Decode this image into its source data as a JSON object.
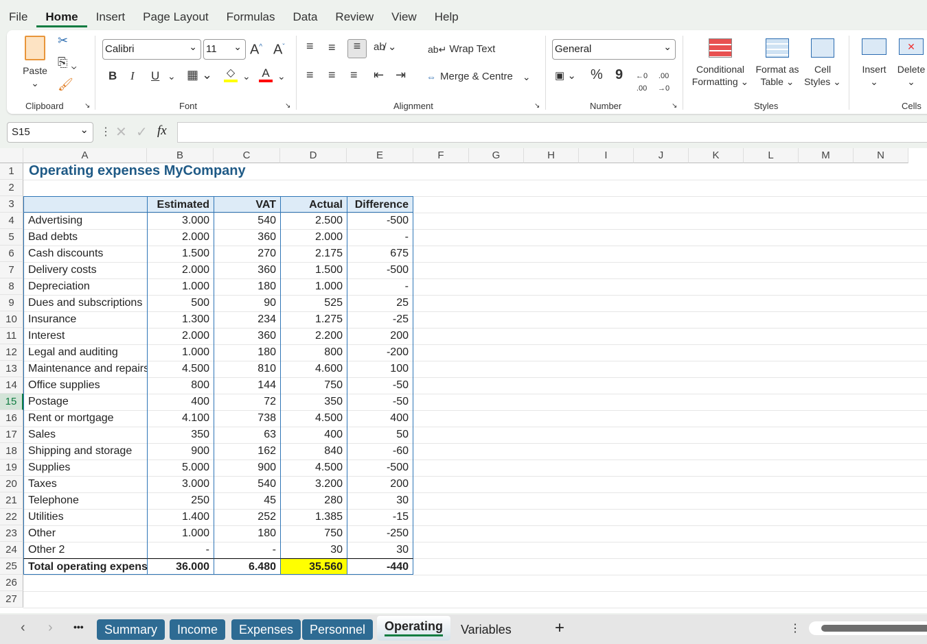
{
  "menu": [
    "File",
    "Home",
    "Insert",
    "Page Layout",
    "Formulas",
    "Data",
    "Review",
    "View",
    "Help"
  ],
  "ribbon": {
    "clipboard": {
      "label": "Clipboard",
      "paste": "Paste"
    },
    "font": {
      "label": "Font",
      "name": "Calibri",
      "size": "11",
      "bold": "B",
      "italic": "I",
      "underline": "U",
      "fill_color": "#ffff00",
      "font_color": "#ff0000"
    },
    "alignment": {
      "label": "Alignment",
      "wrap": "Wrap Text",
      "merge": "Merge & Centre"
    },
    "number": {
      "label": "Number",
      "format": "General",
      "percent": "%",
      "comma": "9"
    },
    "styles": {
      "label": "Styles",
      "conditional": [
        "Conditional",
        "Formatting"
      ],
      "format_table": [
        "Format as",
        "Table"
      ],
      "cell_styles": [
        "Cell",
        "Styles"
      ]
    },
    "cells": {
      "label": "Cells",
      "insert": "Insert",
      "delete": "Delete"
    }
  },
  "formula_bar": {
    "name_box": "S15",
    "fx": "fx",
    "value": ""
  },
  "columns": [
    "A",
    "B",
    "C",
    "D",
    "E",
    "F",
    "G",
    "H",
    "I",
    "J",
    "K",
    "L",
    "M",
    "N"
  ],
  "rows": [
    "1",
    "2",
    "3",
    "4",
    "5",
    "6",
    "7",
    "8",
    "9",
    "10",
    "11",
    "12",
    "13",
    "14",
    "15",
    "16",
    "17",
    "18",
    "19",
    "20",
    "21",
    "22",
    "23",
    "24",
    "25",
    "26",
    "27"
  ],
  "selected_row": "15",
  "title": "Operating expenses MyCompany",
  "table": {
    "headers": [
      "",
      "Estimated",
      "VAT",
      "Actual",
      "Difference"
    ],
    "rows": [
      [
        "Advertising",
        "3.000",
        "540",
        "2.500",
        "-500"
      ],
      [
        "Bad debts",
        "2.000",
        "360",
        "2.000",
        "-"
      ],
      [
        "Cash discounts",
        "1.500",
        "270",
        "2.175",
        "675"
      ],
      [
        "Delivery costs",
        "2.000",
        "360",
        "1.500",
        "-500"
      ],
      [
        "Depreciation",
        "1.000",
        "180",
        "1.000",
        "-"
      ],
      [
        "Dues and subscriptions",
        "500",
        "90",
        "525",
        "25"
      ],
      [
        "Insurance",
        "1.300",
        "234",
        "1.275",
        "-25"
      ],
      [
        "Interest",
        "2.000",
        "360",
        "2.200",
        "200"
      ],
      [
        "Legal and auditing",
        "1.000",
        "180",
        "800",
        "-200"
      ],
      [
        "Maintenance and repairs",
        "4.500",
        "810",
        "4.600",
        "100"
      ],
      [
        "Office supplies",
        "800",
        "144",
        "750",
        "-50"
      ],
      [
        "Postage",
        "400",
        "72",
        "350",
        "-50"
      ],
      [
        "Rent or mortgage",
        "4.100",
        "738",
        "4.500",
        "400"
      ],
      [
        "Sales",
        "350",
        "63",
        "400",
        "50"
      ],
      [
        "Shipping and storage",
        "900",
        "162",
        "840",
        "-60"
      ],
      [
        "Supplies",
        "5.000",
        "900",
        "4.500",
        "-500"
      ],
      [
        "Taxes",
        "3.000",
        "540",
        "3.200",
        "200"
      ],
      [
        "Telephone",
        "250",
        "45",
        "280",
        "30"
      ],
      [
        "Utilities",
        "1.400",
        "252",
        "1.385",
        "-15"
      ],
      [
        "Other",
        "1.000",
        "180",
        "750",
        "-250"
      ],
      [
        "Other 2",
        "-",
        "-",
        "30",
        "30"
      ]
    ],
    "total": [
      "Total operating expenses",
      "36.000",
      "6.480",
      "35.560",
      "-440"
    ],
    "highlight_color": "#ffff00"
  },
  "sheet_tabs": [
    "Summary",
    "Income",
    "Expenses",
    "Personnel",
    "Operating",
    "Variables"
  ],
  "active_tab": "Operating",
  "add_sheet": "+"
}
